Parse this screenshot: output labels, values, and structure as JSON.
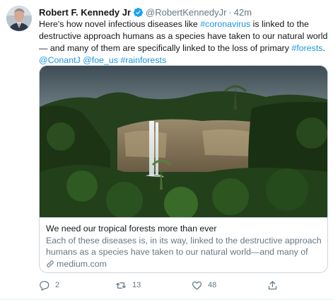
{
  "tweet": {
    "author_name": "Robert F. Kennedy Jr",
    "handle": "@RobertKennedyJr",
    "separator": "·",
    "time": "42m",
    "text_parts": [
      "Here's how novel infectious diseases like ",
      "#coronavirus",
      " is linked to the destructive approach humans as a species have taken to our natural world — and many of them are specifically linked to the loss of primary ",
      "#forests",
      ". ",
      "@ConantJ",
      " ",
      "@foe_us",
      " ",
      "#rainforests"
    ]
  },
  "card": {
    "title": "We need our tropical forests more than ever",
    "description": "Each of these diseases is, in its way, linked to the destructive approach humans as a species have taken to our natural world—and many of",
    "domain": "medium.com"
  },
  "actions": {
    "reply_count": "2",
    "retweet_count": "13",
    "like_count": "48"
  },
  "colors": {
    "link": "#1b95e0",
    "secondary": "#657786",
    "border": "#ccd6dd"
  },
  "icons": [
    "verified-badge-icon",
    "reply-icon",
    "retweet-icon",
    "like-icon",
    "share-icon",
    "link-icon"
  ]
}
